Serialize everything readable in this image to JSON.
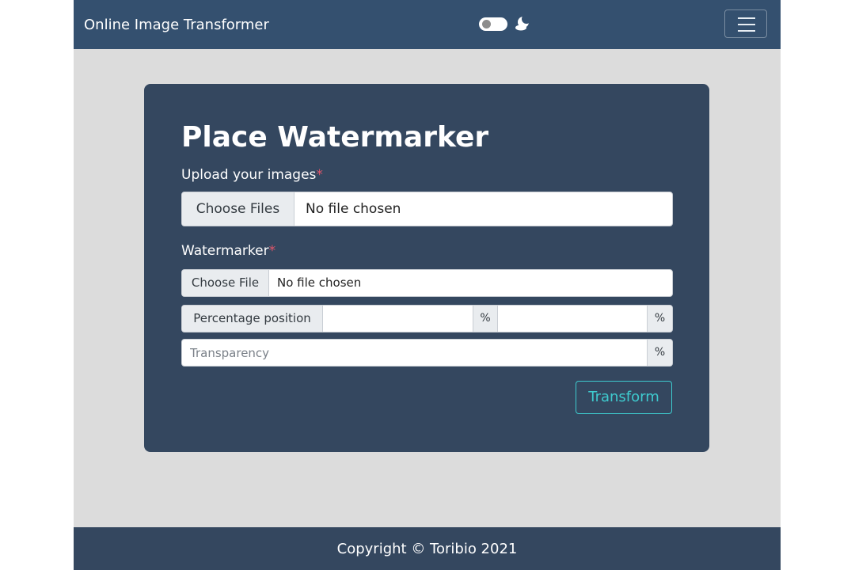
{
  "navbar": {
    "brand": "Online Image Transformer",
    "theme_toggle_on": false,
    "theme_icon": "moon-icon",
    "menu_icon": "hamburger-icon"
  },
  "form": {
    "title": "Place Watermarker",
    "images_field": {
      "label": "Upload your images",
      "required_mark": "*",
      "button_label": "Choose Files",
      "status": "No file chosen"
    },
    "watermark_field": {
      "label": "Watermarker",
      "required_mark": "*",
      "button_label": "Choose File",
      "status": "No file chosen"
    },
    "position_field": {
      "label": "Percentage position",
      "x_value": "",
      "y_value": "",
      "x_unit": "%",
      "y_unit": "%"
    },
    "transparency_field": {
      "placeholder": "Transparency",
      "value": "",
      "unit": "%"
    },
    "submit_label": "Transform"
  },
  "footer": {
    "text": "Copyright © Toribio 2021"
  },
  "colors": {
    "navbar": "#34506f",
    "card": "#34475f",
    "page_background": "#dcdcdc",
    "accent": "#3ecbcf",
    "required": "#e0566b"
  }
}
